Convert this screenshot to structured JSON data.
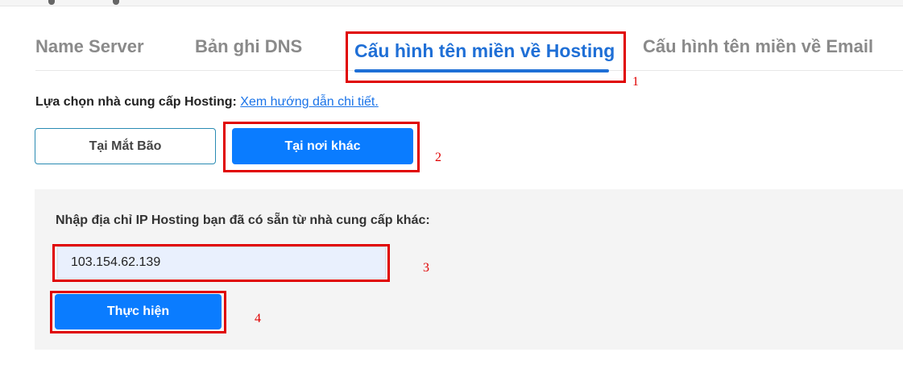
{
  "tabs": [
    {
      "label": "Name Server"
    },
    {
      "label": "Bản ghi DNS"
    },
    {
      "label": "Cấu hình tên miền về Hosting",
      "active": true
    },
    {
      "label": "Cấu hình tên miền về Email"
    }
  ],
  "provider": {
    "label": "Lựa chọn nhà cung cấp Hosting:",
    "link_text": "Xem hướng dẫn chi tiết."
  },
  "options": {
    "matbao_label": "Tại Mắt Bão",
    "other_label": "Tại nơi khác",
    "selected": "other"
  },
  "panel": {
    "label": "Nhập địa chỉ IP Hosting bạn đã có sẵn từ nhà cung cấp khác:",
    "ip_value": "103.154.62.139",
    "submit_label": "Thực hiện"
  },
  "annotations": [
    "1",
    "2",
    "3",
    "4"
  ],
  "colors": {
    "accent": "#0a7cff",
    "active_tab": "#1f6fd6",
    "annotation": "#e00000",
    "panel_bg": "#f4f4f4"
  }
}
